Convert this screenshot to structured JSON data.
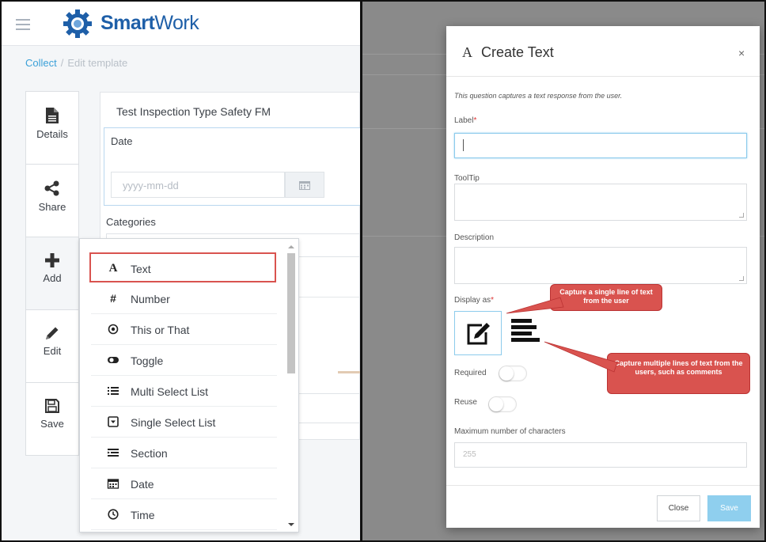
{
  "app": {
    "brand_primary": "Smart",
    "brand_secondary": "Work",
    "brand_color": "#1e5fa8"
  },
  "breadcrumb": {
    "root": "Collect",
    "separator": "/",
    "current": "Edit template"
  },
  "side_tabs": [
    {
      "label": "Details",
      "icon": "document-icon"
    },
    {
      "label": "Share",
      "icon": "share-icon"
    },
    {
      "label": "Add",
      "icon": "plus-icon"
    },
    {
      "label": "Edit",
      "icon": "pencil-icon"
    },
    {
      "label": "Save",
      "icon": "floppy-icon"
    }
  ],
  "form": {
    "title": "Test Inspection Type Safety FM",
    "date_label": "Date",
    "date_placeholder": "yyyy-mm-dd",
    "categories_label": "Categories"
  },
  "add_menu": {
    "items": [
      {
        "label": "Text",
        "icon": "A",
        "highlighted": true
      },
      {
        "label": "Number",
        "icon": "#"
      },
      {
        "label": "This or That",
        "icon": "radio-icon"
      },
      {
        "label": "Toggle",
        "icon": "toggle-icon"
      },
      {
        "label": "Multi Select List",
        "icon": "list-icon"
      },
      {
        "label": "Single Select List",
        "icon": "select-icon"
      },
      {
        "label": "Section",
        "icon": "section-icon"
      },
      {
        "label": "Date",
        "icon": "calendar-icon"
      },
      {
        "label": "Time",
        "icon": "clock-icon"
      }
    ],
    "highlight_color": "#d9534f"
  },
  "modal": {
    "icon": "A",
    "title": "Create Text",
    "close": "×",
    "description": "This question captures a text response from the user.",
    "label_field": {
      "label": "Label",
      "required_mark": "*",
      "value": ""
    },
    "tooltip_field": {
      "label": "ToolTip",
      "value": ""
    },
    "description_field": {
      "label": "Description",
      "value": ""
    },
    "display_as": {
      "label": "Display as",
      "required_mark": "*"
    },
    "required_toggle": {
      "label": "Required",
      "on": false
    },
    "reuse_toggle": {
      "label": "Reuse",
      "on": false
    },
    "max_chars": {
      "label": "Maximum number of characters",
      "placeholder": "255"
    },
    "close_button": "Close",
    "save_button": "Save",
    "save_color": "#8fcfee"
  },
  "callouts": {
    "single_line": "Capture a single line of text from the user",
    "multi_line": "Capture multiple lines of text from the users, such as comments",
    "color": "#d9534f"
  }
}
